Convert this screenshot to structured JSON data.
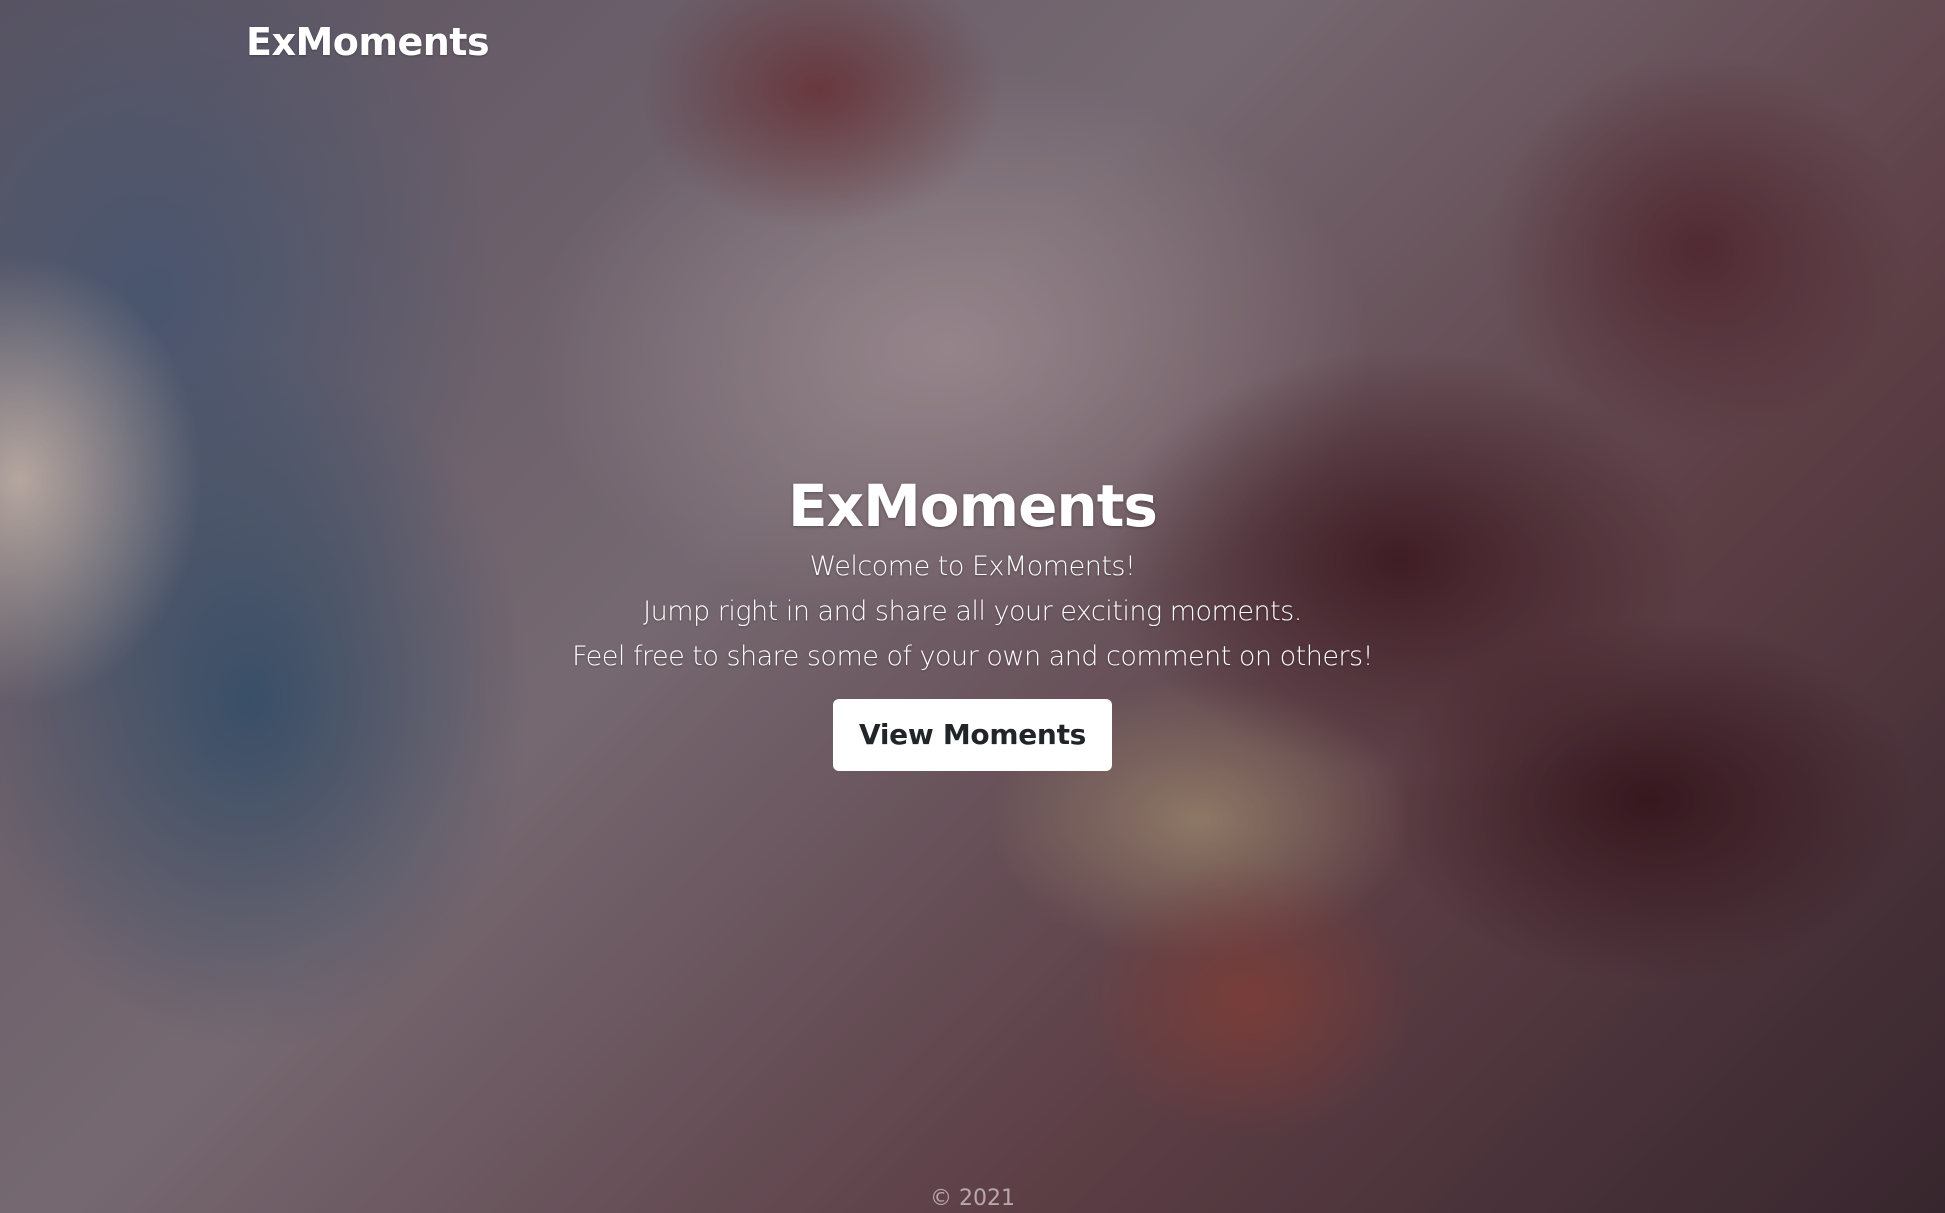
{
  "navbar": {
    "brand": "ExMoments"
  },
  "hero": {
    "title": "ExMoments",
    "lines": [
      "Welcome to ExMoments!",
      "Jump right in and share all your exciting moments.",
      "Feel free to share some of your own and comment on others!"
    ],
    "button_label": "View Moments"
  },
  "footer": {
    "text": "© 2021"
  },
  "colors": {
    "text": "#ffffff",
    "button_bg": "#ffffff",
    "button_text": "#212529"
  }
}
